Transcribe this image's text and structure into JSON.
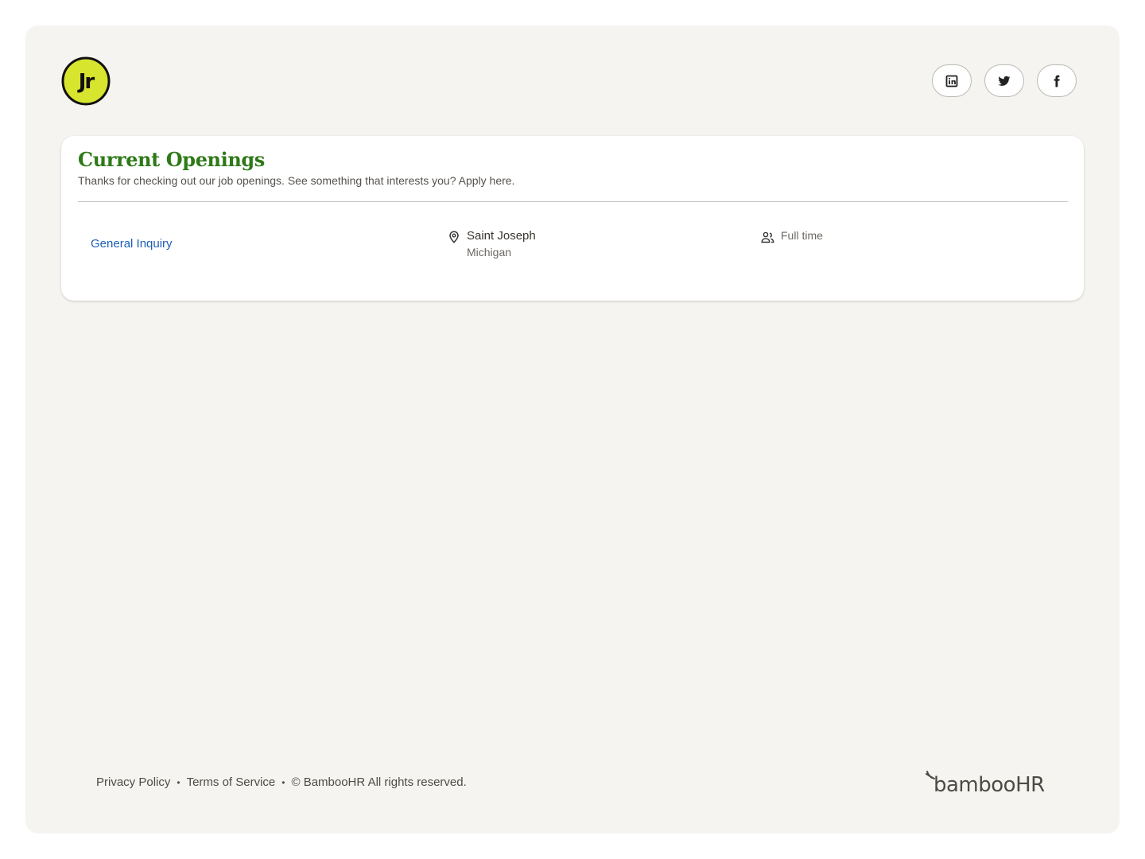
{
  "header": {
    "logo": {
      "icon": "jr-logo",
      "text": "Jr",
      "colors": {
        "fill": "#d8e52f",
        "ring": "#111111"
      }
    },
    "social": [
      {
        "id": "linkedin",
        "icon": "linkedin-icon"
      },
      {
        "id": "twitter",
        "icon": "twitter-icon"
      },
      {
        "id": "facebook",
        "icon": "facebook-icon"
      }
    ]
  },
  "openings": {
    "title": "Current Openings",
    "subtitle": "Thanks for checking out our job openings. See something that interests you? Apply here.",
    "jobs": [
      {
        "title": "General Inquiry",
        "location": {
          "city": "Saint Joseph",
          "state": "Michigan",
          "icon": "location-pin-icon"
        },
        "type": "Full time",
        "type_icon": "person-icon"
      }
    ]
  },
  "footer": {
    "links": [
      "Privacy Policy",
      "Terms of Service"
    ],
    "separator": "•",
    "copyright": "© BambooHR All rights reserved.",
    "brand": "bambooHR"
  },
  "colors": {
    "title_green": "#2e7918",
    "link_blue": "#1d5fb4",
    "page_bg": "#f5f4f1"
  }
}
